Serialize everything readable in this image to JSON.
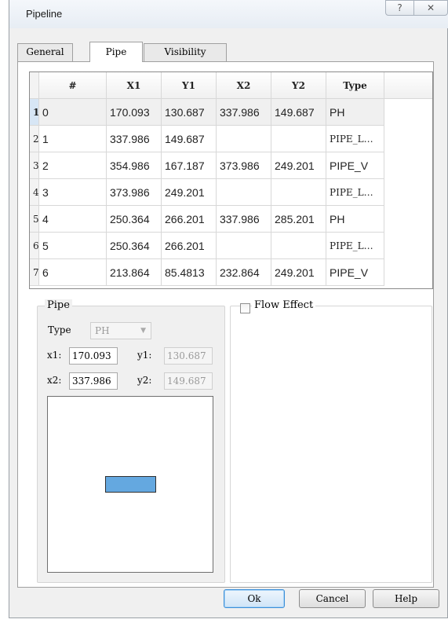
{
  "window": {
    "title": "Pipeline",
    "help_glyph": "?",
    "close_glyph": "✕"
  },
  "tabs": [
    {
      "label": "General"
    },
    {
      "label": "Pipe"
    },
    {
      "label": "Visibility"
    }
  ],
  "active_tab": "Pipe",
  "table": {
    "headers": [
      "#",
      "X1",
      "Y1",
      "X2",
      "Y2",
      "Type"
    ],
    "rows": [
      {
        "row_num": "1",
        "cells": [
          "0",
          "170.093",
          "130.687",
          "337.986",
          "149.687",
          "PH"
        ]
      },
      {
        "row_num": "2",
        "cells": [
          "1",
          "337.986",
          "149.687",
          "",
          "",
          "PIPE_L…"
        ]
      },
      {
        "row_num": "3",
        "cells": [
          "2",
          "354.986",
          "167.187",
          "373.986",
          "249.201",
          "PIPE_V"
        ]
      },
      {
        "row_num": "4",
        "cells": [
          "3",
          "373.986",
          "249.201",
          "",
          "",
          "PIPE_L…"
        ]
      },
      {
        "row_num": "5",
        "cells": [
          "4",
          "250.364",
          "266.201",
          "337.986",
          "285.201",
          "PH"
        ]
      },
      {
        "row_num": "6",
        "cells": [
          "5",
          "250.364",
          "266.201",
          "",
          "",
          "PIPE_L…"
        ]
      },
      {
        "row_num": "7",
        "cells": [
          "6",
          "213.864",
          "85.4813",
          "232.864",
          "249.201",
          "PIPE_V"
        ]
      }
    ]
  },
  "pipe_group": {
    "title": "Pipe",
    "type_label": "Type",
    "type_value": "PH",
    "x1_label": "x1:",
    "x1_value": "170.093",
    "y1_label": "y1:",
    "y1_value": "130.687",
    "x2_label": "x2:",
    "x2_value": "337.986",
    "y2_label": "y2:",
    "y2_value": "149.687",
    "preview_fill_color": "#64a8e0"
  },
  "flow_effect": {
    "label": "Flow Effect",
    "checked": false
  },
  "buttons": {
    "ok": "Ok",
    "cancel": "Cancel",
    "help": "Help"
  }
}
